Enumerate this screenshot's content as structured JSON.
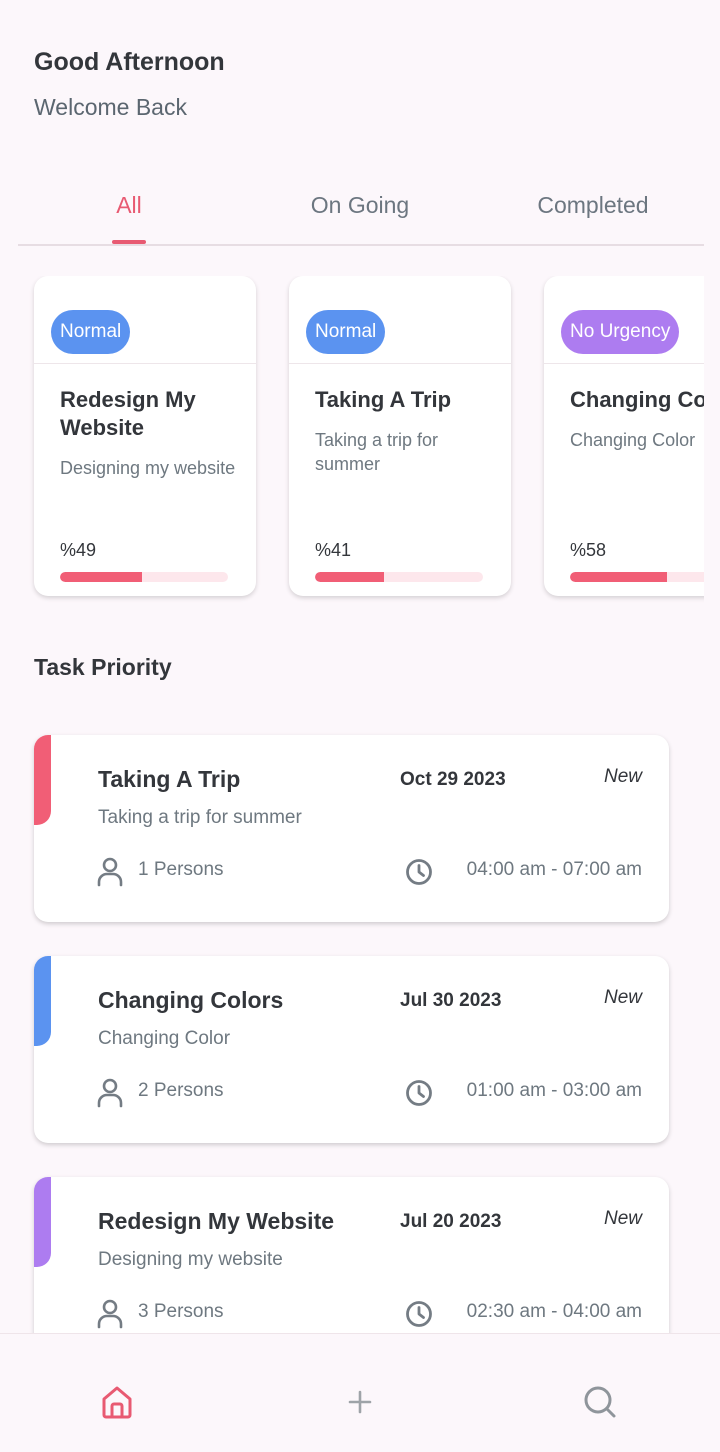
{
  "header": {
    "greeting": "Good Afternoon",
    "subtitle": "Welcome Back"
  },
  "tabs": [
    {
      "label": "All",
      "active": true
    },
    {
      "label": "On Going",
      "active": false
    },
    {
      "label": "Completed",
      "active": false
    }
  ],
  "cards": [
    {
      "badge": "Normal",
      "badge_color": "#5b93f0",
      "title": "Redesign My Website",
      "description": "Designing my website",
      "percent_label": "%49",
      "progress": 0.49
    },
    {
      "badge": "Normal",
      "badge_color": "#5b93f0",
      "title": "Taking A Trip",
      "description": "Taking a trip for summer",
      "percent_label": "%41",
      "progress": 0.41
    },
    {
      "badge": "No Urgency",
      "badge_color": "#ad7cf0",
      "title": "Changing Colors",
      "description": "Changing Color",
      "percent_label": "%58",
      "progress": 0.58
    }
  ],
  "task_priority": {
    "title": "Task Priority",
    "tasks": [
      {
        "title": "Taking A Trip",
        "date": "Oct 29 2023",
        "status": "New",
        "description": "Taking a trip for summer",
        "persons": "1 Persons",
        "time": "04:00 am - 07:00 am",
        "accent_color": "#f15e76"
      },
      {
        "title": "Changing Colors",
        "date": "Jul 30 2023",
        "status": "New",
        "description": "Changing Color",
        "persons": "2 Persons",
        "time": "01:00 am - 03:00 am",
        "accent_color": "#5b93f0"
      },
      {
        "title": "Redesign My Website",
        "date": "Jul 20 2023",
        "status": "New",
        "description": "Designing my website",
        "persons": "3 Persons",
        "time": "02:30 am - 04:00 am",
        "accent_color": "#ad7cf0"
      }
    ]
  },
  "bottom_nav": [
    {
      "icon": "home-icon",
      "active": true
    },
    {
      "icon": "plus-icon",
      "active": false
    },
    {
      "icon": "search-icon",
      "active": false
    }
  ],
  "colors": {
    "accent": "#e85a72",
    "progress_fill": "#f15e76",
    "progress_track": "#fde7ec",
    "background": "#fcf7fb"
  }
}
